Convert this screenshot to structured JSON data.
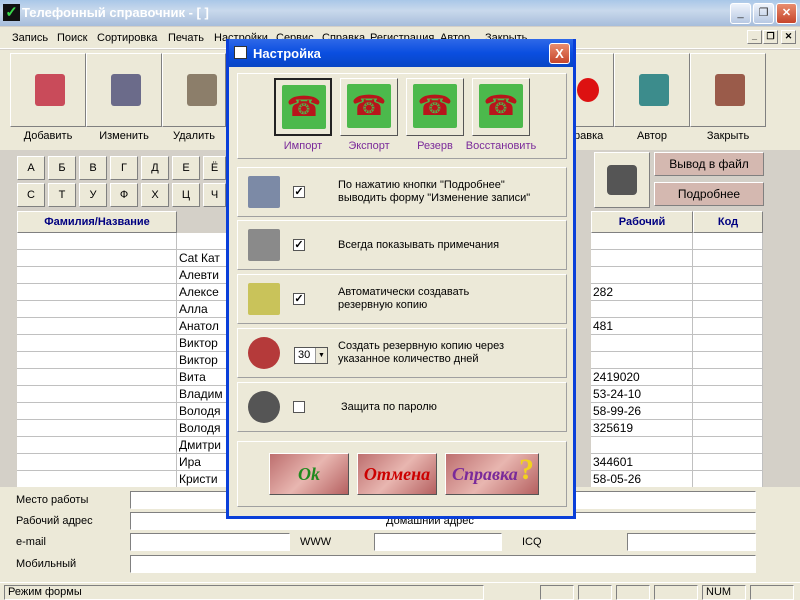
{
  "window": {
    "title": "Телефонный справочник - [ ]",
    "menu": [
      "Запись",
      "Поиск",
      "Сортировка",
      "Печать",
      "Настройки",
      "Сервис",
      "Справка",
      "Регистрация",
      "Автор",
      "Закрыть"
    ]
  },
  "toolbar": {
    "left": [
      {
        "label": "Добавить",
        "icon": "add-record-icon"
      },
      {
        "label": "Изменить",
        "icon": "edit-record-icon"
      },
      {
        "label": "Удалить",
        "icon": "delete-record-icon"
      }
    ],
    "right": [
      {
        "label": "Справка",
        "icon": "apple-help-icon"
      },
      {
        "label": "Автор",
        "icon": "author-spy-icon"
      },
      {
        "label": "Закрыть",
        "icon": "close-door-icon"
      }
    ]
  },
  "alphabet": {
    "row1": [
      "А",
      "Б",
      "В",
      "Г",
      "Д",
      "Е",
      "Ё"
    ],
    "row2": [
      "С",
      "Т",
      "У",
      "Ф",
      "Х",
      "Ц",
      "Ч"
    ]
  },
  "side_buttons": {
    "export_file": "Вывод в файл",
    "details": "Подробнее"
  },
  "grid": {
    "headers": {
      "name": "Фамилия/Название",
      "work": "Рабочий",
      "code": "Код"
    },
    "names": [
      "",
      "Cat Кат",
      "Алевти",
      "Алексе",
      "Алла",
      "Анатол",
      "Виктор",
      "Виктор",
      "Вита",
      "Владим",
      "Володя",
      "Володя",
      "Дмитри",
      "Ира",
      "Кристи"
    ],
    "work": [
      "",
      "",
      "",
      "282",
      "",
      "481",
      "",
      "",
      "2419020",
      "53-24-10",
      "58-99-26",
      "325619",
      "",
      "344601",
      "58-05-26"
    ]
  },
  "fields": {
    "workplace": "Место работы",
    "work_address": "Рабочий адрес",
    "home_address": "Домашний адрес",
    "email": "e-mail",
    "www": "WWW",
    "icq": "ICQ",
    "mobile": "Мобильный"
  },
  "status": {
    "mode": "Режим формы",
    "num": "NUM"
  },
  "dialog": {
    "title": "Настройка",
    "close": "X",
    "actions": [
      {
        "label": "Импорт",
        "icon": "import-phone-icon"
      },
      {
        "label": "Экспорт",
        "icon": "export-phone-icon"
      },
      {
        "label": "Резерв",
        "icon": "backup-phone-icon"
      },
      {
        "label": "Восстановить",
        "icon": "restore-phone-icon"
      }
    ],
    "options": [
      {
        "text1": "По нажатию кнопки \"Подробнее\"",
        "text2": "выводить форму \"Изменение записи\"",
        "checked": true,
        "icon": "form-icon"
      },
      {
        "text1": "Всегда показывать примечания",
        "text2": "",
        "checked": true,
        "icon": "notes-icon"
      },
      {
        "text1": "Автоматически создавать",
        "text2": "резервную копию",
        "checked": true,
        "icon": "auto-backup-icon"
      },
      {
        "text1": "Создать резервную копию через",
        "text2": "указанное количество дней",
        "spin": "30",
        "icon": "clock-icon"
      },
      {
        "text1": "Защита по паролю",
        "text2": "",
        "checked": false,
        "icon": "lock-icon"
      }
    ],
    "buttons": {
      "ok": "Ok",
      "cancel": "Отмена",
      "help": "Справка",
      "help_mark": "?"
    }
  }
}
